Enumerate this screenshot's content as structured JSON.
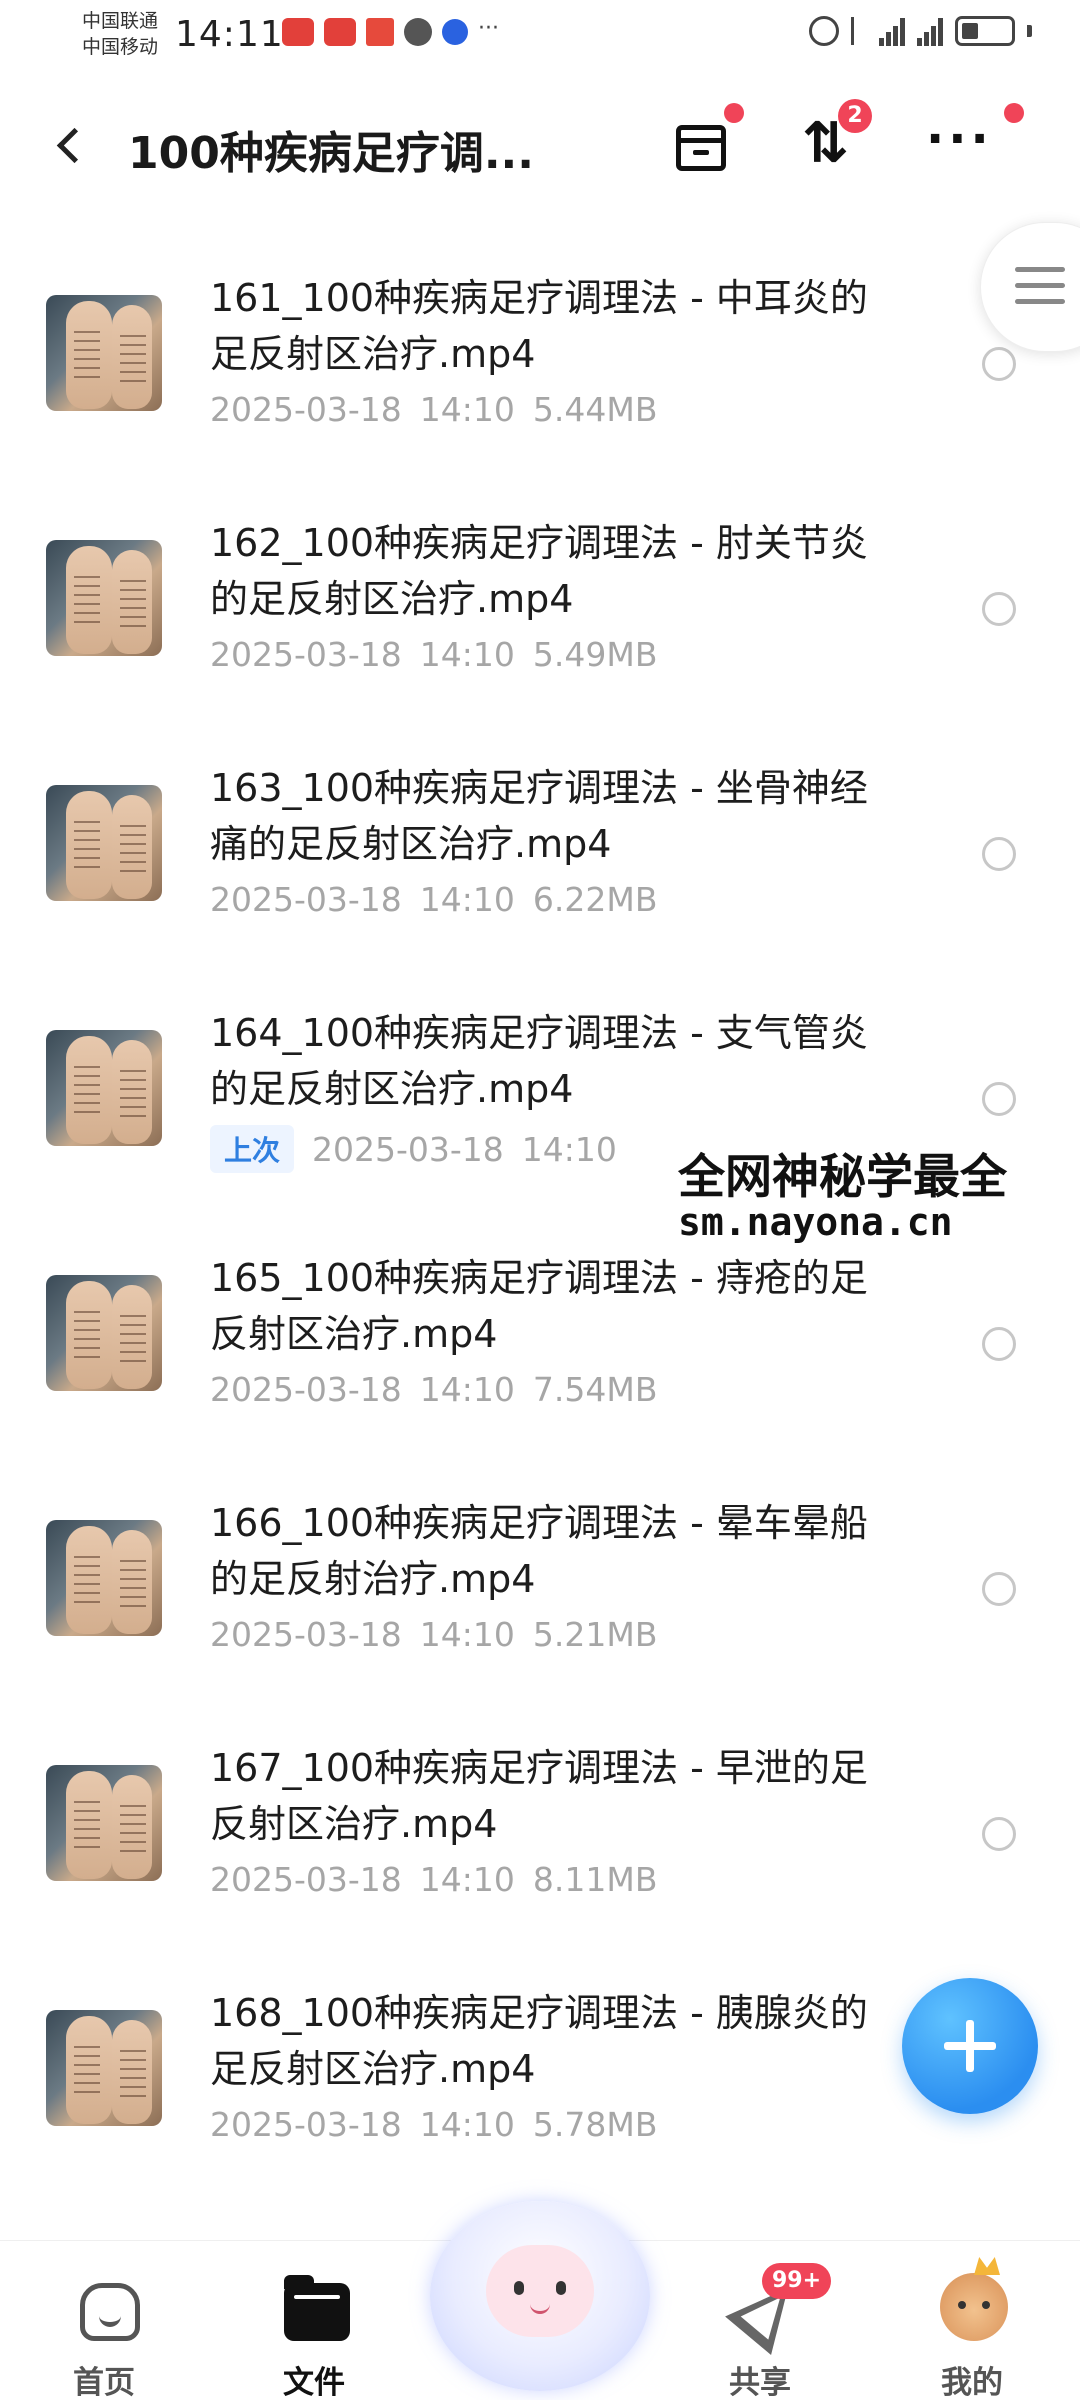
{
  "status_bar": {
    "carrier_1": "中国联通",
    "carrier_2": "中国移动",
    "time": "14:11",
    "notification_dots": "···"
  },
  "header": {
    "title": "100种疾病足疗调...",
    "sort_glyph": "⇅",
    "sort_badge": "2",
    "more_glyph": "···"
  },
  "files": [
    {
      "name": "161_100种疾病足疗调理法 - 中耳炎的足反射区治疗.mp4",
      "date": "2025-03-18",
      "time": "14:10",
      "size": "5.44MB",
      "tag": ""
    },
    {
      "name": "162_100种疾病足疗调理法 - 肘关节炎的足反射区治疗.mp4",
      "date": "2025-03-18",
      "time": "14:10",
      "size": "5.49MB",
      "tag": ""
    },
    {
      "name": "163_100种疾病足疗调理法 - 坐骨神经痛的足反射区治疗.mp4",
      "date": "2025-03-18",
      "time": "14:10",
      "size": "6.22MB",
      "tag": ""
    },
    {
      "name": "164_100种疾病足疗调理法 - 支气管炎的足反射区治疗.mp4",
      "date": "2025-03-18",
      "time": "14:10",
      "size": "",
      "tag": "上次"
    },
    {
      "name": "165_100种疾病足疗调理法 - 痔疮的足反射区治疗.mp4",
      "date": "2025-03-18",
      "time": "14:10",
      "size": "7.54MB",
      "tag": ""
    },
    {
      "name": "166_100种疾病足疗调理法 - 晕车晕船的足反射治疗.mp4",
      "date": "2025-03-18",
      "time": "14:10",
      "size": "5.21MB",
      "tag": ""
    },
    {
      "name": "167_100种疾病足疗调理法 - 早泄的足反射区治疗.mp4",
      "date": "2025-03-18",
      "time": "14:10",
      "size": "8.11MB",
      "tag": ""
    },
    {
      "name": "168_100种疾病足疗调理法 - 胰腺炎的足反射区治疗.mp4",
      "date": "2025-03-18",
      "time": "14:10",
      "size": "5.78MB",
      "tag": ""
    }
  ],
  "watermark": {
    "line1": "全网神秘学最全",
    "line2": "sm.nayona.cn"
  },
  "bottom_nav": {
    "home": "首页",
    "files": "文件",
    "share": "共享",
    "share_badge": "99+",
    "mine": "我的"
  },
  "colors": {
    "accent": "#2b8ef0",
    "badge": "#f04458",
    "meta_text": "#a6a6a6"
  }
}
